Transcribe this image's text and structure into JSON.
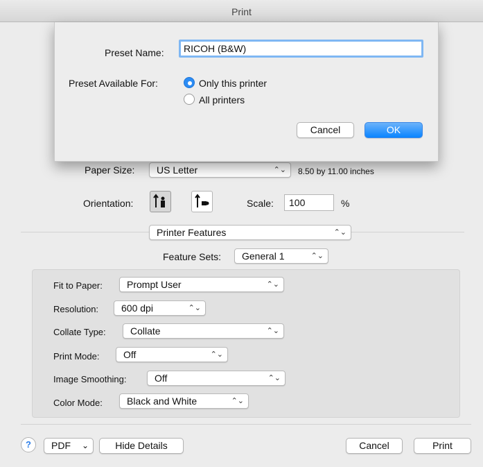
{
  "window": {
    "title": "Print"
  },
  "sheet": {
    "preset_name_label": "Preset Name:",
    "preset_name_value": "RICOH (B&W)",
    "available_for_label": "Preset Available For:",
    "option_only": "Only this printer",
    "option_all": "All printers",
    "selected_option": "Only this printer",
    "cancel_label": "Cancel",
    "ok_label": "OK"
  },
  "page_setup": {
    "paper_size_label": "Paper Size:",
    "paper_size_value": "US Letter",
    "paper_size_dims": "8.50 by 11.00 inches",
    "orientation_label": "Orientation:",
    "orientation_selected": "portrait",
    "scale_label": "Scale:",
    "scale_value": "100",
    "scale_unit": "%"
  },
  "section": {
    "popup_value": "Printer Features",
    "feature_sets_label": "Feature Sets:",
    "feature_sets_value": "General 1"
  },
  "features": {
    "fit_label": "Fit to Paper:",
    "fit_value": "Prompt User",
    "resolution_label": "Resolution:",
    "resolution_value": "600 dpi",
    "collate_label": "Collate Type:",
    "collate_value": "Collate",
    "print_mode_label": "Print Mode:",
    "print_mode_value": "Off",
    "smoothing_label": "Image Smoothing:",
    "smoothing_value": "Off",
    "color_label": "Color Mode:",
    "color_value": "Black and White"
  },
  "footer": {
    "help_glyph": "?",
    "pdf_label": "PDF",
    "hide_details_label": "Hide Details",
    "cancel_label": "Cancel",
    "print_label": "Print"
  },
  "icons": {
    "popup_arrows": "⌃⌄",
    "pdf_chevron": "⌄"
  },
  "colors": {
    "accent": "#0a84ff",
    "focus_ring": "#7fb7f3"
  }
}
